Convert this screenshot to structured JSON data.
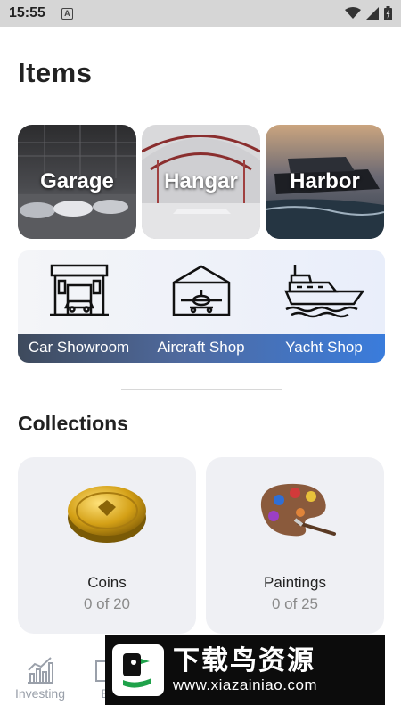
{
  "status_bar": {
    "time": "15:55",
    "notification_badge": "A"
  },
  "page": {
    "title": "Items"
  },
  "places": [
    {
      "label": "Garage"
    },
    {
      "label": "Hangar"
    },
    {
      "label": "Harbor"
    }
  ],
  "shops": [
    {
      "label": "Car Showroom",
      "icon": "car-showroom-icon"
    },
    {
      "label": "Aircraft Shop",
      "icon": "aircraft-hangar-icon"
    },
    {
      "label": "Yacht Shop",
      "icon": "yacht-icon"
    }
  ],
  "collections": {
    "title": "Collections",
    "items": [
      {
        "name": "Coins",
        "count": "0 of 20",
        "icon": "coin-icon"
      },
      {
        "name": "Paintings",
        "count": "0 of 25",
        "icon": "palette-icon"
      }
    ]
  },
  "nav": {
    "items": [
      {
        "label": "Investing",
        "icon": "chart-icon"
      },
      {
        "label": "B",
        "icon": "nav-icon"
      }
    ]
  },
  "watermark": {
    "big": "下载鸟资源",
    "small": "www.xiazainiao.com"
  },
  "colors": {
    "accent_blue": "#3a7cdc",
    "card_bg": "#eff0f4",
    "muted_text": "#8a8a8a"
  }
}
